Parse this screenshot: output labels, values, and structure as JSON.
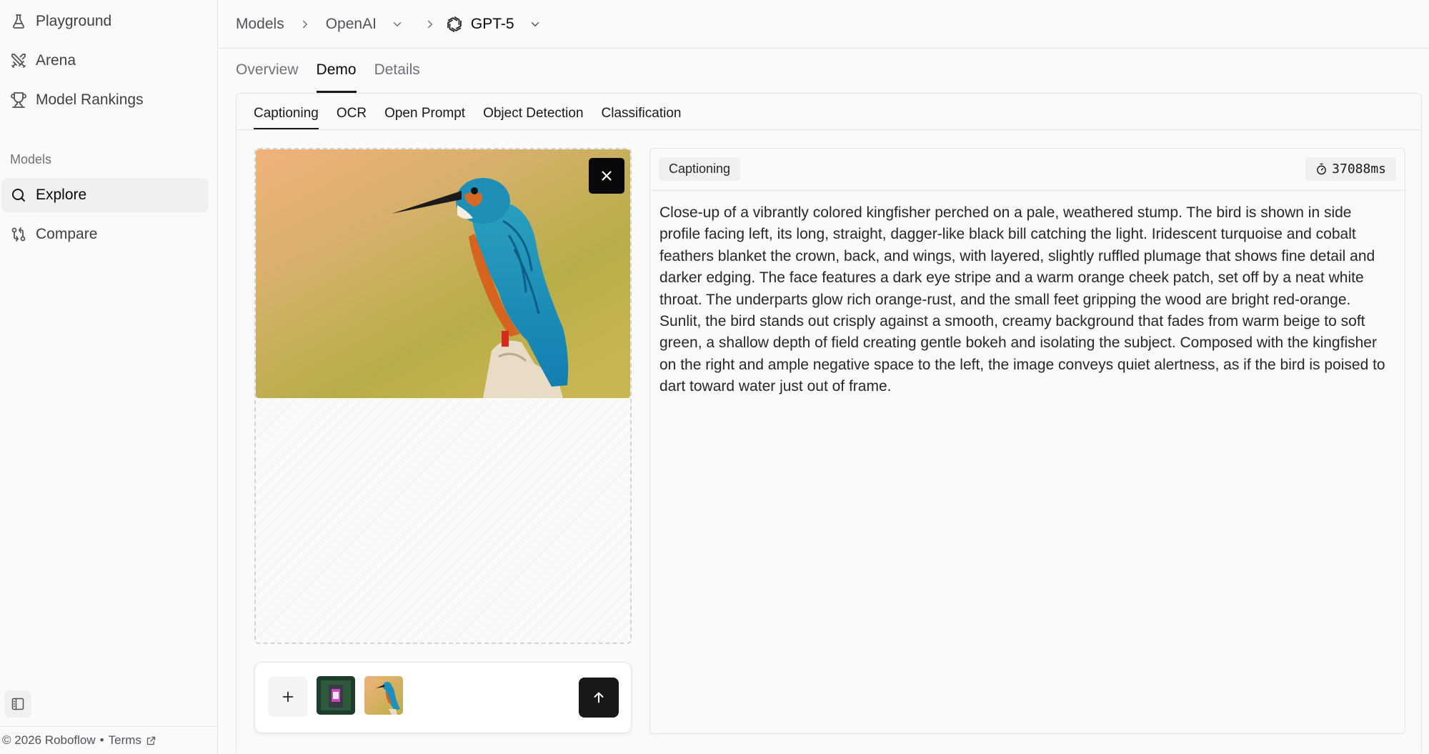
{
  "sidebar": {
    "top_items": [
      {
        "label": "Playground",
        "icon": "flask-icon"
      },
      {
        "label": "Arena",
        "icon": "swords-icon"
      },
      {
        "label": "Model Rankings",
        "icon": "trophy-icon"
      }
    ],
    "section_label": "Models",
    "model_items": [
      {
        "label": "Explore",
        "icon": "search-icon",
        "active": true
      },
      {
        "label": "Compare",
        "icon": "compare-icon",
        "active": false
      }
    ],
    "footer": {
      "copyright": "© 2026 Roboflow",
      "separator": "•",
      "terms": "Terms"
    }
  },
  "breadcrumb": {
    "models": "Models",
    "provider": "OpenAI",
    "model": "GPT-5"
  },
  "main_tabs": [
    {
      "label": "Overview",
      "active": false
    },
    {
      "label": "Demo",
      "active": true
    },
    {
      "label": "Details",
      "active": false
    }
  ],
  "sub_tabs": [
    {
      "label": "Captioning",
      "active": true
    },
    {
      "label": "OCR",
      "active": false
    },
    {
      "label": "Open Prompt",
      "active": false
    },
    {
      "label": "Object Detection",
      "active": false
    },
    {
      "label": "Classification",
      "active": false
    }
  ],
  "result": {
    "task_label": "Captioning",
    "latency": "37088ms",
    "caption": "Close-up of a vibrantly colored kingfisher perched on a pale, weathered stump. The bird is shown in side profile facing left, its long, straight, dagger-like black bill catching the light. Iridescent turquoise and cobalt feathers blanket the crown, back, and wings, with layered, slightly ruffled plumage that shows fine detail and darker edging. The face features a dark eye stripe and a warm orange cheek patch, set off by a neat white throat. The underparts glow rich orange-rust, and the small feet gripping the wood are bright red-orange. Sunlit, the bird stands out crisply against a smooth, creamy background that fades from warm beige to soft green, a shallow depth of field creating gentle bokeh and isolating the subject. Composed with the kingfisher on the right and ample negative space to the left, the image conveys quiet alertness, as if the bird is poised to dart toward water just out of frame."
  },
  "colors": {
    "accent_dark": "#18181b",
    "sidebar_active_bg": "#f0f0f1",
    "border": "#e4e4e7"
  }
}
